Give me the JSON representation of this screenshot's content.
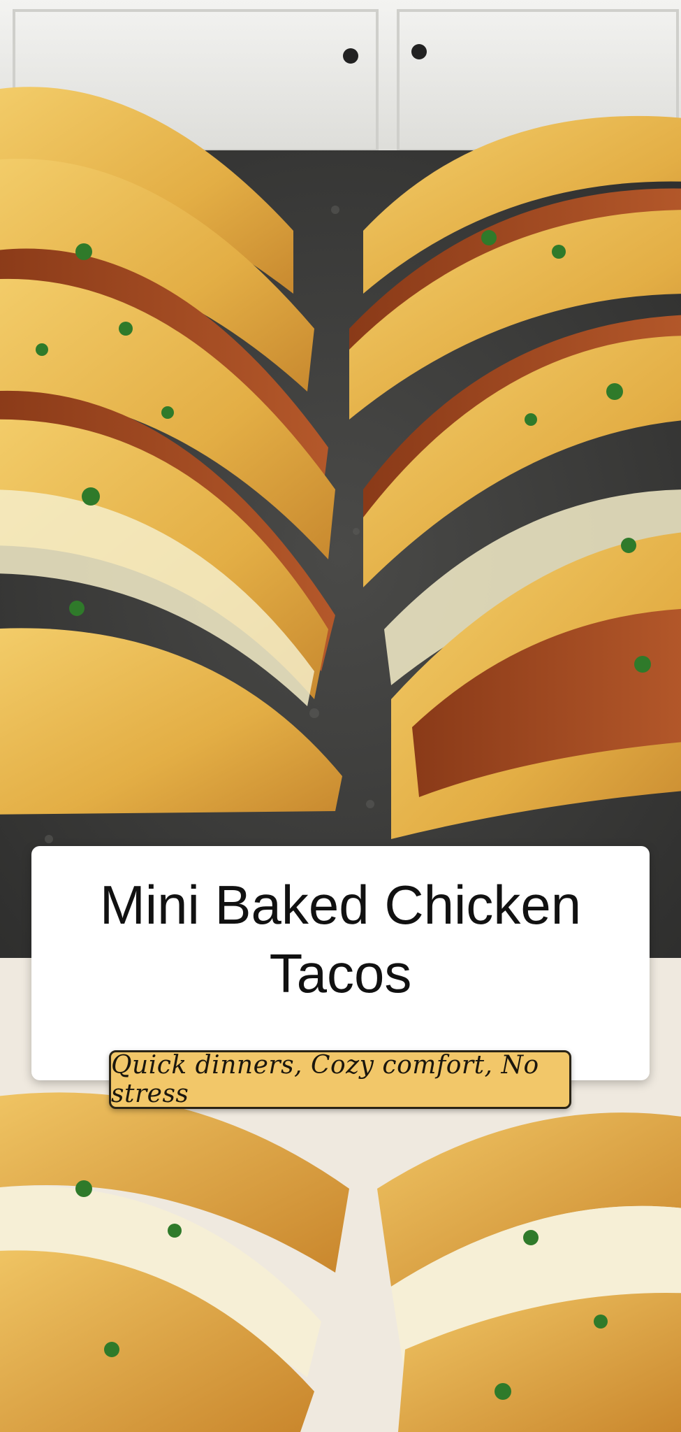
{
  "title": "Mini Baked Chicken Tacos",
  "tagline": "Quick dinners, Cozy comfort, No stress",
  "photos": {
    "top": "baked-chicken-tacos-photo",
    "bottom": "baked-chicken-tacos-tray-photo"
  }
}
